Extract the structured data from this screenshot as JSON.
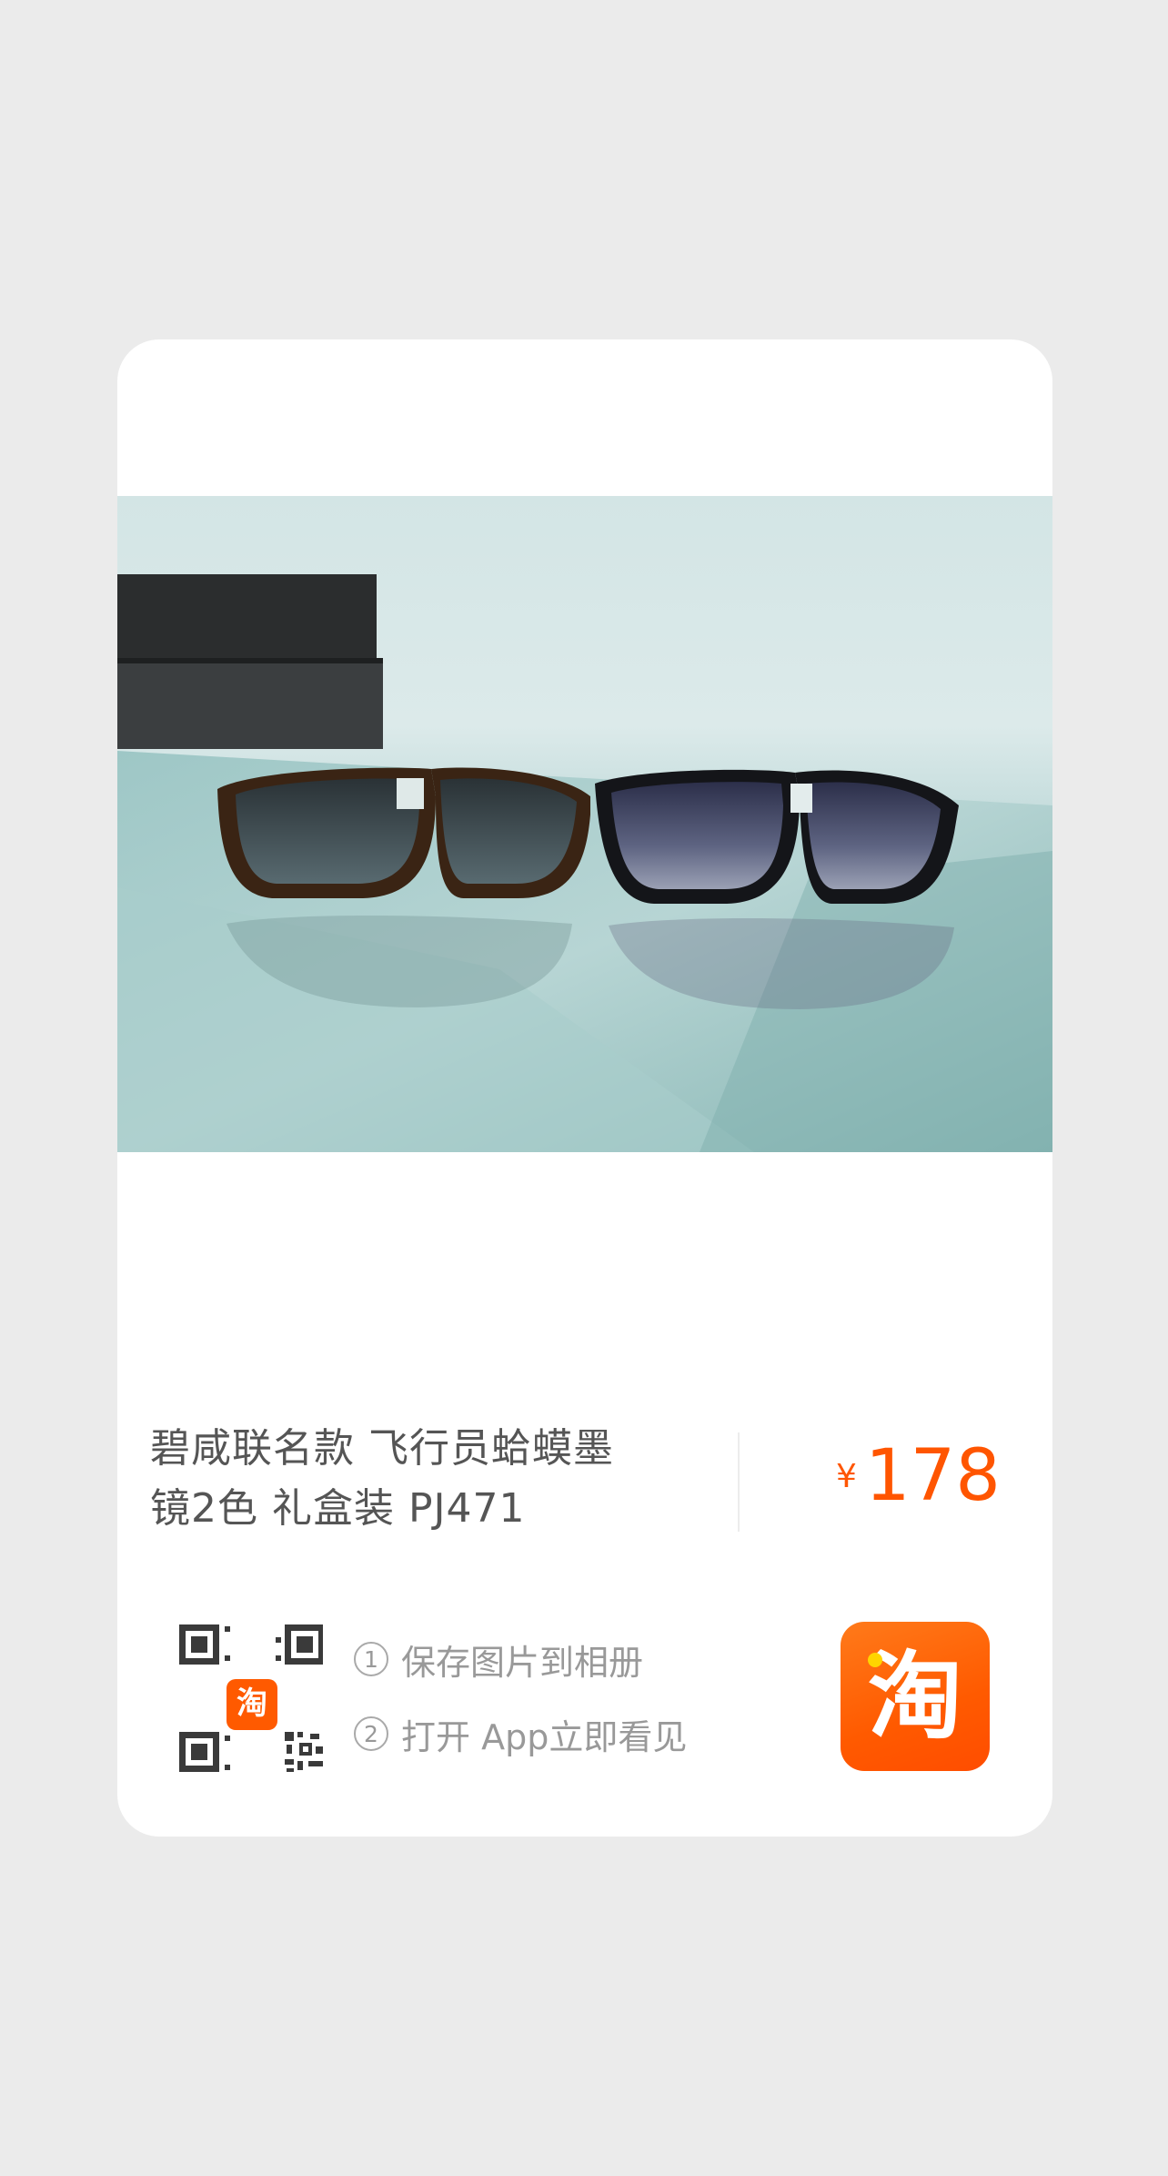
{
  "product": {
    "title_line1": "碧咸联名款  飞行员蛤蟆墨",
    "title_line2": "镜2色 礼盒装 PJ471",
    "image_alt": "product-photo-two-aviator-sunglasses",
    "price_currency": "¥",
    "price_amount": "178"
  },
  "share": {
    "step1_num": "1",
    "step1_text": "保存图片到相册",
    "step2_num": "2",
    "step2_text": "打开 App立即看见",
    "qr_badge_glyph": "淘"
  },
  "app_logo": {
    "glyph": "淘",
    "icon": "taobao-app-icon"
  },
  "colors": {
    "background": "#ebebeb",
    "card": "#ffffff",
    "accent": "#ff5500",
    "title_text": "#555555",
    "secondary_text": "#999999"
  }
}
